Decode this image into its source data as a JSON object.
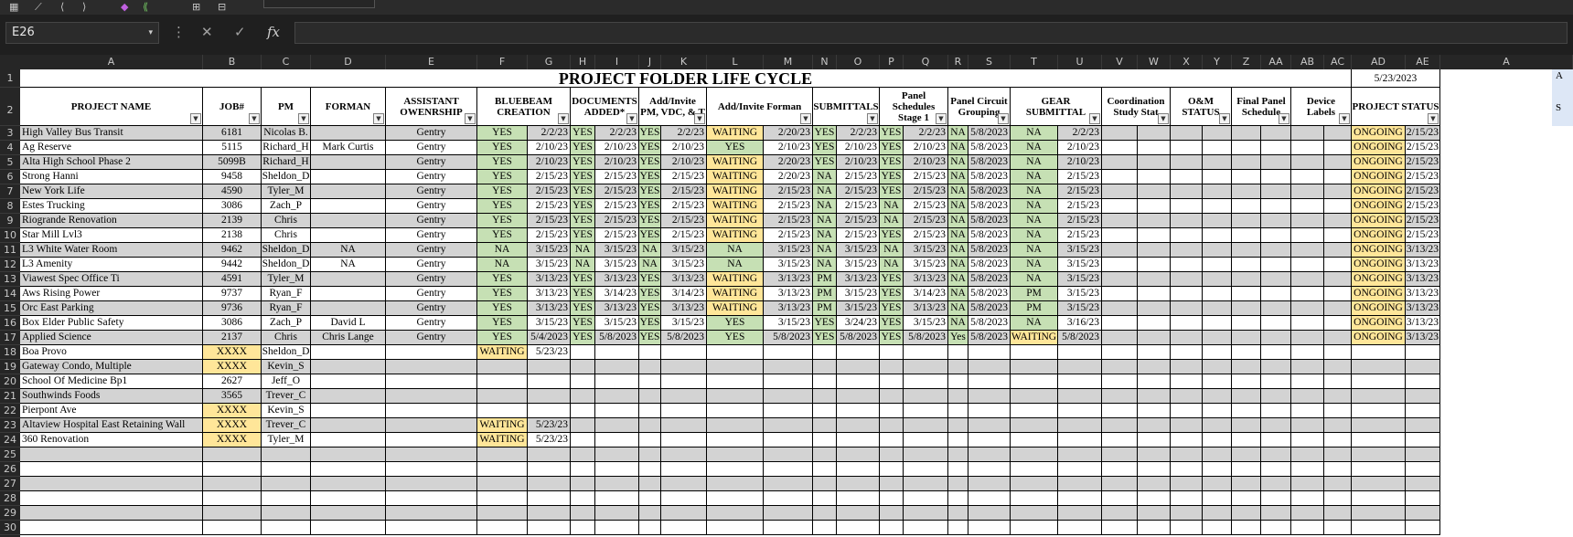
{
  "toolbar": {
    "items": [
      "▦",
      "⟋",
      "⟨",
      "⟩",
      "◆",
      "⟪",
      "⊞",
      "⊟"
    ]
  },
  "formula_bar": {
    "name_box": "E26",
    "dropdown": "▾",
    "more": "⋮",
    "cancel": "✕",
    "enter": "✓",
    "fx": "fx",
    "formula": ""
  },
  "columns": [
    "A",
    "B",
    "C",
    "D",
    "E",
    "F",
    "G",
    "H",
    "I",
    "J",
    "K",
    "L",
    "M",
    "N",
    "O",
    "P",
    "Q",
    "R",
    "S",
    "T",
    "U",
    "V",
    "W",
    "X",
    "Y",
    "Z",
    "AA",
    "AB",
    "AC",
    "AD",
    "AE",
    "A"
  ],
  "row_numbers": [
    "1",
    "2",
    "3",
    "4",
    "5",
    "6",
    "7",
    "8",
    "9",
    "10",
    "11",
    "12",
    "13",
    "14",
    "15",
    "16",
    "17",
    "18",
    "19",
    "20",
    "21",
    "22",
    "23",
    "24",
    "25",
    "26",
    "27",
    "28",
    "29",
    "30"
  ],
  "title": "PROJECT FOLDER LIFE CYCLE",
  "report_date": "5/23/2023",
  "edge_text": {
    "row1": "A",
    "row2": "S"
  },
  "headers": [
    "PROJECT NAME",
    "JOB#",
    "PM",
    "FORMAN",
    "ASSISTANT OWENRSHIP",
    "BLUEBEAM CREATION",
    "DOCUMENTS ADDED*",
    "Add/Invite PM, VDC, & T",
    "Add/Invite Forman",
    "SUBMITTALS",
    "Panel Schedules Stage 1",
    "Panel Circuit Grouping",
    "GEAR SUBMITTAL",
    "Coordination Study Stat",
    "O&M STATUS",
    "Final Panel Schedule",
    "Device Labels",
    "PROJECT STATUS"
  ],
  "rows": [
    {
      "name": "High Valley Bus Transit",
      "job": "6181",
      "pm": "Nicolas B.",
      "forman": "",
      "asst": "Gentry",
      "bb": "YES",
      "bb_d": "2/2/23",
      "doc": "YES",
      "doc_d": "2/2/23",
      "inv": "YES",
      "inv_d": "2/2/23",
      "fm": "WAITING",
      "fm_d": "2/20/23",
      "sub": "YES",
      "sub_d": "2/2/23",
      "ps": "YES",
      "ps_d": "2/2/23",
      "pc": "NA",
      "pc_d": "5/8/2023",
      "gear": "NA",
      "gear_d": "2/2/23",
      "st": "ONGOING",
      "st_d": "2/15/23"
    },
    {
      "name": "Ag Reserve",
      "job": "5115",
      "pm": "Richard_H",
      "forman": "Mark Curtis",
      "asst": "Gentry",
      "bb": "YES",
      "bb_d": "2/10/23",
      "doc": "YES",
      "doc_d": "2/10/23",
      "inv": "YES",
      "inv_d": "2/10/23",
      "fm": "YES",
      "fm_d": "2/10/23",
      "sub": "YES",
      "sub_d": "2/10/23",
      "ps": "YES",
      "ps_d": "2/10/23",
      "pc": "NA",
      "pc_d": "5/8/2023",
      "gear": "NA",
      "gear_d": "2/10/23",
      "st": "ONGOING",
      "st_d": "2/15/23"
    },
    {
      "name": "Alta High School Phase 2",
      "job": "5099B",
      "pm": "Richard_H",
      "forman": "",
      "asst": "Gentry",
      "bb": "YES",
      "bb_d": "2/10/23",
      "doc": "YES",
      "doc_d": "2/10/23",
      "inv": "YES",
      "inv_d": "2/10/23",
      "fm": "WAITING",
      "fm_d": "2/20/23",
      "sub": "YES",
      "sub_d": "2/10/23",
      "ps": "YES",
      "ps_d": "2/10/23",
      "pc": "NA",
      "pc_d": "5/8/2023",
      "gear": "NA",
      "gear_d": "2/10/23",
      "st": "ONGOING",
      "st_d": "2/15/23"
    },
    {
      "name": "Strong  Hanni",
      "job": "9458",
      "pm": "Sheldon_D",
      "forman": "",
      "asst": "Gentry",
      "bb": "YES",
      "bb_d": "2/15/23",
      "doc": "YES",
      "doc_d": "2/15/23",
      "inv": "YES",
      "inv_d": "2/15/23",
      "fm": "WAITING",
      "fm_d": "2/20/23",
      "sub": "NA",
      "sub_d": "2/15/23",
      "ps": "YES",
      "ps_d": "2/15/23",
      "pc": "NA",
      "pc_d": "5/8/2023",
      "gear": "NA",
      "gear_d": "2/15/23",
      "st": "ONGOING",
      "st_d": "2/15/23"
    },
    {
      "name": "New York Life",
      "job": "4590",
      "pm": "Tyler_M",
      "forman": "",
      "asst": "Gentry",
      "bb": "YES",
      "bb_d": "2/15/23",
      "doc": "YES",
      "doc_d": "2/15/23",
      "inv": "YES",
      "inv_d": "2/15/23",
      "fm": "WAITING",
      "fm_d": "2/15/23",
      "sub": "NA",
      "sub_d": "2/15/23",
      "ps": "YES",
      "ps_d": "2/15/23",
      "pc": "NA",
      "pc_d": "5/8/2023",
      "gear": "NA",
      "gear_d": "2/15/23",
      "st": "ONGOING",
      "st_d": "2/15/23"
    },
    {
      "name": "Estes Trucking",
      "job": "3086",
      "pm": "Zach_P",
      "forman": "",
      "asst": "Gentry",
      "bb": "YES",
      "bb_d": "2/15/23",
      "doc": "YES",
      "doc_d": "2/15/23",
      "inv": "YES",
      "inv_d": "2/15/23",
      "fm": "WAITING",
      "fm_d": "2/15/23",
      "sub": "NA",
      "sub_d": "2/15/23",
      "ps": "NA",
      "ps_d": "2/15/23",
      "pc": "NA",
      "pc_d": "5/8/2023",
      "gear": "NA",
      "gear_d": "2/15/23",
      "st": "ONGOING",
      "st_d": "2/15/23"
    },
    {
      "name": "Riogrande Renovation",
      "job": "2139",
      "pm": "Chris",
      "forman": "",
      "asst": "Gentry",
      "bb": "YES",
      "bb_d": "2/15/23",
      "doc": "YES",
      "doc_d": "2/15/23",
      "inv": "YES",
      "inv_d": "2/15/23",
      "fm": "WAITING",
      "fm_d": "2/15/23",
      "sub": "NA",
      "sub_d": "2/15/23",
      "ps": "NA",
      "ps_d": "2/15/23",
      "pc": "NA",
      "pc_d": "5/8/2023",
      "gear": "NA",
      "gear_d": "2/15/23",
      "st": "ONGOING",
      "st_d": "2/15/23"
    },
    {
      "name": "Star Mill Lvl3",
      "job": "2138",
      "pm": "Chris",
      "forman": "",
      "asst": "Gentry",
      "bb": "YES",
      "bb_d": "2/15/23",
      "doc": "YES",
      "doc_d": "2/15/23",
      "inv": "YES",
      "inv_d": "2/15/23",
      "fm": "WAITING",
      "fm_d": "2/15/23",
      "sub": "NA",
      "sub_d": "2/15/23",
      "ps": "YES",
      "ps_d": "2/15/23",
      "pc": "NA",
      "pc_d": "5/8/2023",
      "gear": "NA",
      "gear_d": "2/15/23",
      "st": "ONGOING",
      "st_d": "2/15/23"
    },
    {
      "name": "L3 White Water Room",
      "job": "9462",
      "pm": "Sheldon_D",
      "forman": "NA",
      "asst": "Gentry",
      "bb": "NA",
      "bb_d": "3/15/23",
      "doc": "NA",
      "doc_d": "3/15/23",
      "inv": "NA",
      "inv_d": "3/15/23",
      "fm": "NA",
      "fm_d": "3/15/23",
      "sub": "NA",
      "sub_d": "3/15/23",
      "ps": "NA",
      "ps_d": "3/15/23",
      "pc": "NA",
      "pc_d": "5/8/2023",
      "gear": "NA",
      "gear_d": "3/15/23",
      "st": "ONGOING",
      "st_d": "3/13/23"
    },
    {
      "name": "L3 Amenity",
      "job": "9442",
      "pm": "Sheldon_D",
      "forman": "NA",
      "asst": "Gentry",
      "bb": "NA",
      "bb_d": "3/15/23",
      "doc": "NA",
      "doc_d": "3/15/23",
      "inv": "NA",
      "inv_d": "3/15/23",
      "fm": "NA",
      "fm_d": "3/15/23",
      "sub": "NA",
      "sub_d": "3/15/23",
      "ps": "NA",
      "ps_d": "3/15/23",
      "pc": "NA",
      "pc_d": "5/8/2023",
      "gear": "NA",
      "gear_d": "3/15/23",
      "st": "ONGOING",
      "st_d": "3/13/23"
    },
    {
      "name": "Viawest Spec Office Ti",
      "job": "4591",
      "pm": "Tyler_M",
      "forman": "",
      "asst": "Gentry",
      "bb": "YES",
      "bb_d": "3/13/23",
      "doc": "YES",
      "doc_d": "3/13/23",
      "inv": "YES",
      "inv_d": "3/13/23",
      "fm": "WAITING",
      "fm_d": "3/13/23",
      "sub": "PM",
      "sub_d": "3/13/23",
      "ps": "YES",
      "ps_d": "3/13/23",
      "pc": "NA",
      "pc_d": "5/8/2023",
      "gear": "NA",
      "gear_d": "3/15/23",
      "st": "ONGOING",
      "st_d": "3/13/23"
    },
    {
      "name": "Aws Rising Power",
      "job": "9737",
      "pm": "Ryan_F",
      "forman": "",
      "asst": "Gentry",
      "bb": "YES",
      "bb_d": "3/13/23",
      "doc": "YES",
      "doc_d": "3/14/23",
      "inv": "YES",
      "inv_d": "3/14/23",
      "fm": "WAITING",
      "fm_d": "3/13/23",
      "sub": "PM",
      "sub_d": "3/15/23",
      "ps": "YES",
      "ps_d": "3/14/23",
      "pc": "NA",
      "pc_d": "5/8/2023",
      "gear": "PM",
      "gear_d": "3/15/23",
      "st": "ONGOING",
      "st_d": "3/13/23"
    },
    {
      "name": "Orc East Parking",
      "job": "9736",
      "pm": "Ryan_F",
      "forman": "",
      "asst": "Gentry",
      "bb": "YES",
      "bb_d": "3/13/23",
      "doc": "YES",
      "doc_d": "3/13/23",
      "inv": "YES",
      "inv_d": "3/13/23",
      "fm": "WAITING",
      "fm_d": "3/13/23",
      "sub": "PM",
      "sub_d": "3/15/23",
      "ps": "YES",
      "ps_d": "3/13/23",
      "pc": "NA",
      "pc_d": "5/8/2023",
      "gear": "PM",
      "gear_d": "3/15/23",
      "st": "ONGOING",
      "st_d": "3/13/23"
    },
    {
      "name": "Box Elder Public Safety",
      "job": "3086",
      "pm": "Zach_P",
      "forman": "David L",
      "asst": "Gentry",
      "bb": "YES",
      "bb_d": "3/15/23",
      "doc": "YES",
      "doc_d": "3/15/23",
      "inv": "YES",
      "inv_d": "3/15/23",
      "fm": "YES",
      "fm_d": "3/15/23",
      "sub": "YES",
      "sub_d": "3/24/23",
      "ps": "YES",
      "ps_d": "3/15/23",
      "pc": "NA",
      "pc_d": "5/8/2023",
      "gear": "NA",
      "gear_d": "3/16/23",
      "st": "ONGOING",
      "st_d": "3/13/23"
    },
    {
      "name": "Applied Science",
      "job": "2137",
      "pm": "Chris",
      "forman": "Chris Lange",
      "asst": "Gentry",
      "bb": "YES",
      "bb_d": "5/4/2023",
      "doc": "YES",
      "doc_d": "5/8/2023",
      "inv": "YES",
      "inv_d": "5/8/2023",
      "fm": "YES",
      "fm_d": "5/8/2023",
      "sub": "YES",
      "sub_d": "5/8/2023",
      "ps": "YES",
      "ps_d": "5/8/2023",
      "pc": "Yes",
      "pc_d": "5/8/2023",
      "gear": "WAITING",
      "gear_d": "5/8/2023",
      "st": "ONGOING",
      "st_d": "3/13/23"
    },
    {
      "name": "Boa  Provo",
      "job": "XXXX",
      "pm": "Sheldon_D",
      "forman": "",
      "asst": "",
      "bb": "WAITING",
      "bb_d": "5/23/23"
    },
    {
      "name": "Gateway Condo, Multiple",
      "job": "XXXX",
      "pm": "Kevin_S",
      "forman": "",
      "asst": ""
    },
    {
      "name": "School Of Medicine Bp1",
      "job": "2627",
      "pm": "Jeff_O",
      "forman": "",
      "asst": ""
    },
    {
      "name": "Southwinds Foods",
      "job": "3565",
      "pm": "Trever_C",
      "forman": "",
      "asst": ""
    },
    {
      "name": "Pierpont Ave",
      "job": "XXXX",
      "pm": "Kevin_S",
      "forman": "",
      "asst": ""
    },
    {
      "name": "Altaview Hospital East Retaining Wall",
      "job": "XXXX",
      "pm": "Trever_C",
      "forman": "",
      "asst": "",
      "bb": "WAITING",
      "bb_d": "5/23/23"
    },
    {
      "name": "360 Renovation",
      "job": "XXXX",
      "pm": "Tyler_M",
      "forman": "",
      "asst": "",
      "bb": "WAITING",
      "bb_d": "5/23/23"
    }
  ],
  "colors": {
    "green": "#c6e0b4",
    "yellow": "#ffe699",
    "gray": "#d3d3d3"
  }
}
